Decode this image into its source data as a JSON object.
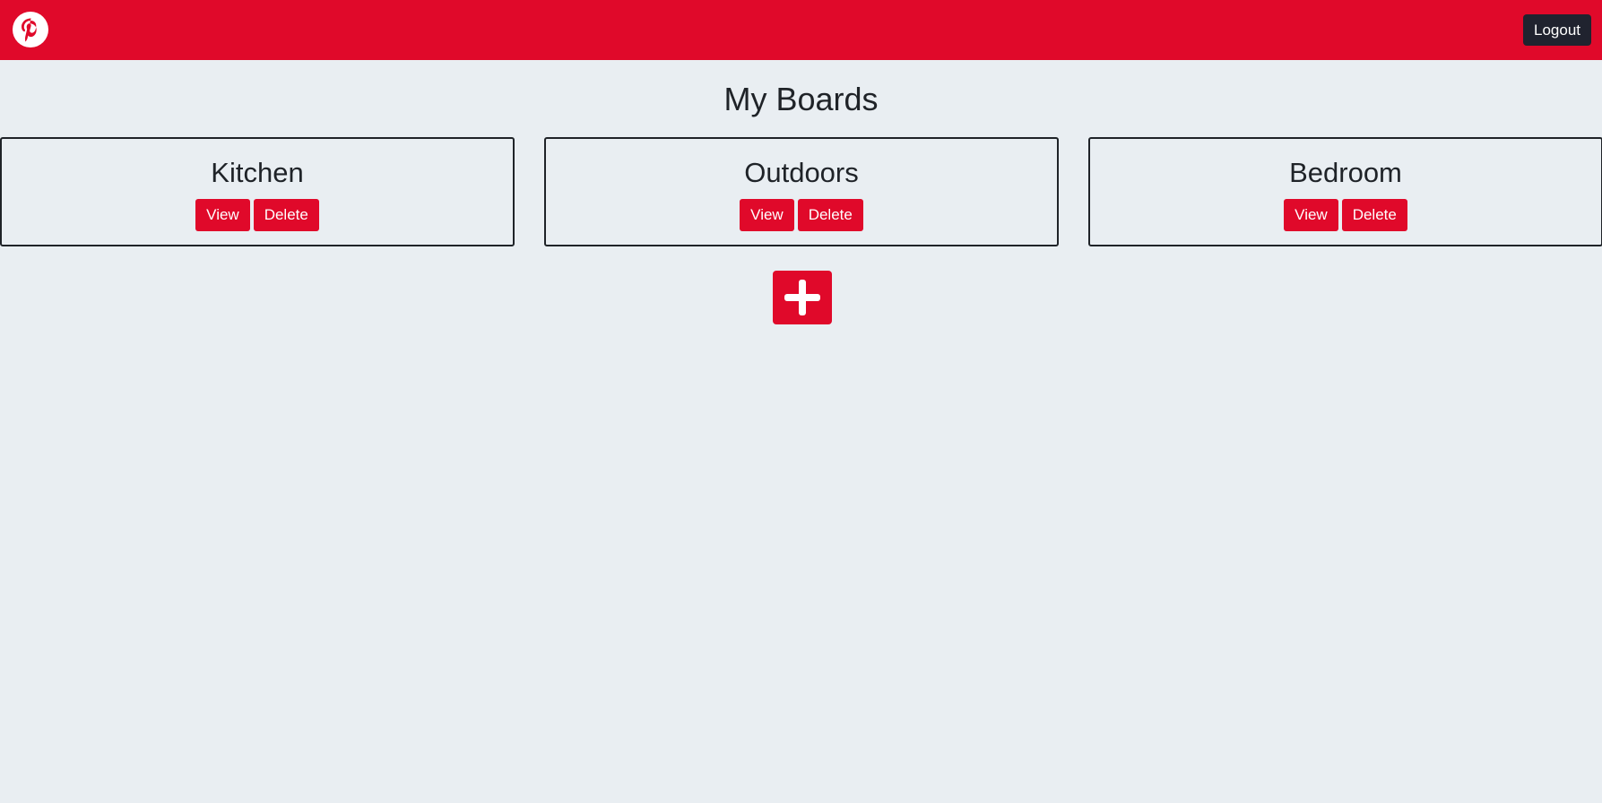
{
  "header": {
    "logo_icon": "pinterest-logo-icon",
    "logout_label": "Logout"
  },
  "page": {
    "title": "My Boards"
  },
  "boards": [
    {
      "name": "Kitchen",
      "view_label": "View",
      "delete_label": "Delete"
    },
    {
      "name": "Outdoors",
      "view_label": "View",
      "delete_label": "Delete"
    },
    {
      "name": "Bedroom",
      "view_label": "View",
      "delete_label": "Delete"
    }
  ],
  "add_board": {
    "icon": "plus-icon"
  },
  "colors": {
    "brand": "#e0092a",
    "dark": "#20232f",
    "background": "#e9eef2"
  }
}
